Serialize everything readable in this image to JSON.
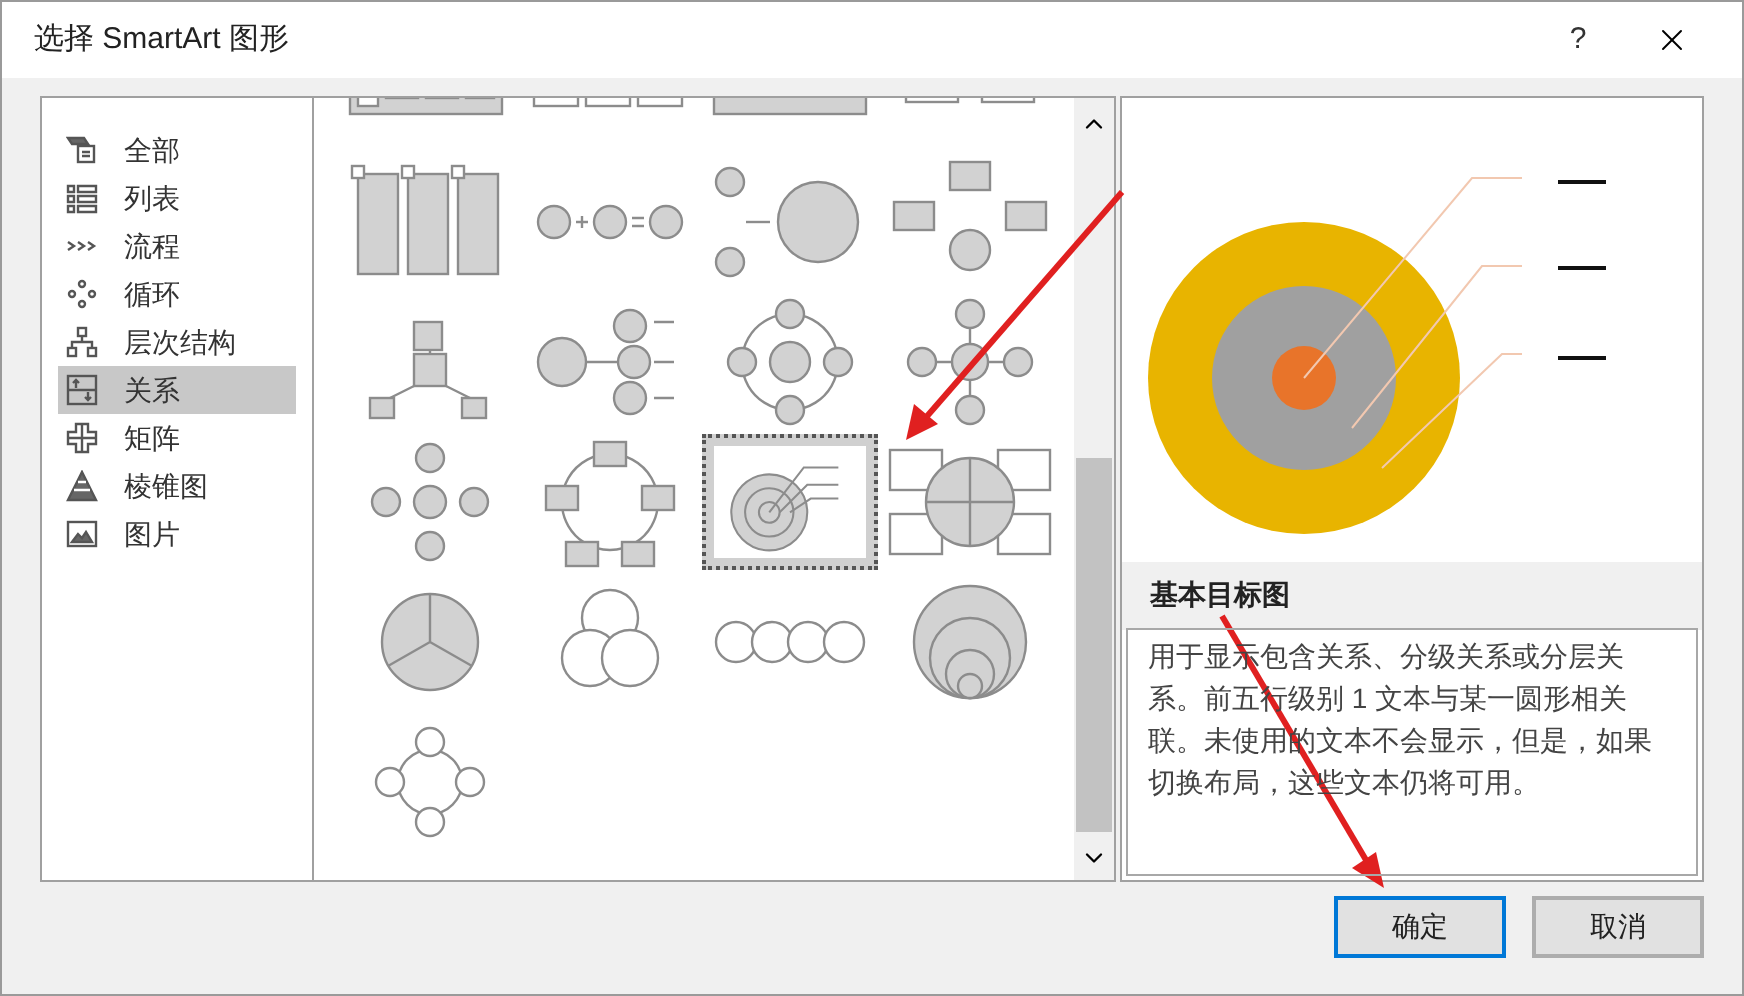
{
  "window": {
    "title": "选择 SmartArt 图形",
    "help": "?"
  },
  "categories": [
    {
      "label": "全部",
      "kind": "all",
      "selected": false
    },
    {
      "label": "列表",
      "kind": "list",
      "selected": false
    },
    {
      "label": "流程",
      "kind": "process",
      "selected": false
    },
    {
      "label": "循环",
      "kind": "cycle",
      "selected": false
    },
    {
      "label": "层次结构",
      "kind": "hierarchy",
      "selected": false
    },
    {
      "label": "关系",
      "kind": "relationship",
      "selected": true
    },
    {
      "label": "矩阵",
      "kind": "matrix",
      "selected": false
    },
    {
      "label": "棱锥图",
      "kind": "pyramid",
      "selected": false
    },
    {
      "label": "图片",
      "kind": "picture",
      "selected": false
    }
  ],
  "gallery": [
    {
      "kind": "block-list",
      "selected": false
    },
    {
      "kind": "box-row",
      "selected": false
    },
    {
      "kind": "arrow-bar",
      "selected": false
    },
    {
      "kind": "bracket-boxes",
      "selected": false
    },
    {
      "kind": "tall-boxes",
      "selected": false
    },
    {
      "kind": "equation",
      "selected": false
    },
    {
      "kind": "merge-circle",
      "selected": false
    },
    {
      "kind": "converge-boxes",
      "selected": false
    },
    {
      "kind": "radial-boxes",
      "selected": false
    },
    {
      "kind": "circle-list",
      "selected": false
    },
    {
      "kind": "cycle-circles",
      "selected": false
    },
    {
      "kind": "cross-circles",
      "selected": false
    },
    {
      "kind": "arrow-cross",
      "selected": false
    },
    {
      "kind": "box-ring",
      "selected": false
    },
    {
      "kind": "target",
      "selected": true
    },
    {
      "kind": "quad-matrix",
      "selected": false
    },
    {
      "kind": "pie",
      "selected": false
    },
    {
      "kind": "venn",
      "selected": false
    },
    {
      "kind": "linked-circles",
      "selected": false
    },
    {
      "kind": "nested-circles",
      "selected": false
    },
    {
      "kind": "circle-ring",
      "selected": false
    }
  ],
  "preview": {
    "title": "基本目标图",
    "description": "用于显示包含关系、分级关系或分层关系。前五行级别 1 文本与某一圆形相关联。未使用的文本不会显示，但是，如果切换布局，这些文本仍将可用。"
  },
  "buttons": [
    {
      "label": "确定",
      "focused": true
    },
    {
      "label": "取消",
      "focused": false
    }
  ]
}
